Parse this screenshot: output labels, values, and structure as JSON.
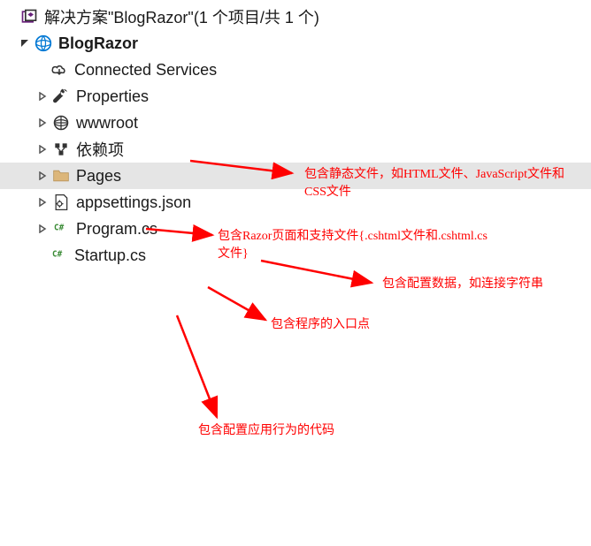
{
  "solution": {
    "title_prefix": "解决方案",
    "solution_name": "\"BlogRazor\"",
    "project_count": "(1 个项目/共 1 个)"
  },
  "project": {
    "name": "BlogRazor"
  },
  "nodes": {
    "connected_services": "Connected Services",
    "properties": "Properties",
    "wwwroot": "wwwroot",
    "dependencies": "依赖项",
    "pages": "Pages",
    "appsettings": "appsettings.json",
    "program": "Program.cs",
    "startup": "Startup.cs"
  },
  "annotations": {
    "wwwroot": "包含静态文件，如HTML文件、JavaScript文件和CSS文件",
    "pages": "包含Razor页面和支持文件{.cshtml文件和.cshtml.cs文件}",
    "appsettings": "包含配置数据，如连接字符串",
    "program": "包含程序的入口点",
    "startup": "包含配置应用行为的代码"
  }
}
